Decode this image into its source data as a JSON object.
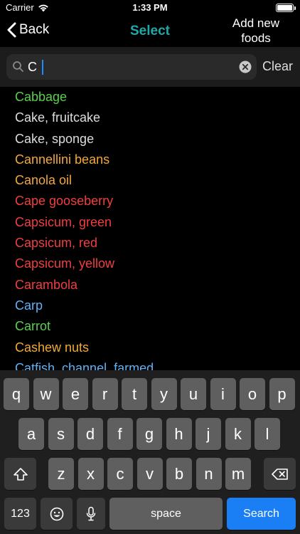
{
  "status": {
    "carrier": "Carrier",
    "time": "1:33 PM"
  },
  "nav": {
    "back_label": "Back",
    "title": "Select",
    "add_line1": "Add new",
    "add_line2": "foods",
    "title_color": "#1fa8a8"
  },
  "search": {
    "value": "C",
    "clear_label": "Clear"
  },
  "foods": [
    {
      "name": "Cabbage",
      "color": "#5ccf4e"
    },
    {
      "name": "Cake, fruitcake",
      "color": "#dddddd"
    },
    {
      "name": "Cake, sponge",
      "color": "#dddddd"
    },
    {
      "name": "Cannellini beans",
      "color": "#f2a93b"
    },
    {
      "name": "Canola oil",
      "color": "#f2a93b"
    },
    {
      "name": "Cape gooseberry",
      "color": "#ef3f3f"
    },
    {
      "name": "Capsicum, green",
      "color": "#ef3f3f"
    },
    {
      "name": "Capsicum, red",
      "color": "#ef3f3f"
    },
    {
      "name": "Capsicum, yellow",
      "color": "#ef3f3f"
    },
    {
      "name": "Carambola",
      "color": "#ef3f3f"
    },
    {
      "name": "Carp",
      "color": "#5fb1f5"
    },
    {
      "name": "Carrot",
      "color": "#5ccf4e"
    },
    {
      "name": "Cashew nuts",
      "color": "#f2a93b"
    },
    {
      "name": "Catfish, channel, farmed",
      "color": "#5fb1f5"
    }
  ],
  "keyboard": {
    "row1": [
      "q",
      "w",
      "e",
      "r",
      "t",
      "y",
      "u",
      "i",
      "o",
      "p"
    ],
    "row2": [
      "a",
      "s",
      "d",
      "f",
      "g",
      "h",
      "j",
      "k",
      "l"
    ],
    "row3": [
      "z",
      "x",
      "c",
      "v",
      "b",
      "n",
      "m"
    ],
    "numbers_label": "123",
    "space_label": "space",
    "search_label": "Search"
  }
}
